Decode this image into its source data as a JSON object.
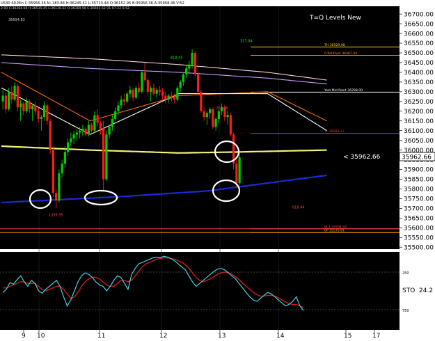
{
  "header": {
    "line1": "US30 60-Min  C:35956.36  N:-183.84  H:36245.41  L:35713.44  O:36152.95  B:35956.36  A:35958.46  V:52",
    "line2": "2.00  C:36364.68  H:36535.45  L:36136.52  O:36169.58  C:36665.52  01-07-22  6:52",
    "indicator_title": "T=Q  Levels  New",
    "corner_value": "36694.83"
  },
  "chart_data": {
    "type": "line",
    "title": "",
    "symbol": "US30",
    "timeframe": "60-Min",
    "price_axis": {
      "ylim": [
        35490,
        36740
      ],
      "ticks": [
        36700,
        36650,
        36600,
        36550,
        36500,
        36450,
        36400,
        36350,
        36300,
        36250,
        36200,
        36150,
        36100,
        36050,
        36000,
        35950,
        35900,
        35850,
        35800,
        35750,
        35700,
        35650,
        35600,
        35550,
        35500
      ],
      "tick_labels": [
        "36700.00",
        "36650.00",
        "36600.00",
        "36550.00",
        "36500.00",
        "36450.00",
        "36400.00",
        "36350.00",
        "36300.00",
        "36250.00",
        "36200.00",
        "36150.00",
        "36100.00",
        "36050.00",
        "36000.00",
        "35950.00",
        "35900.00",
        "35850.00",
        "35800.00",
        "35750.00",
        "35700.00",
        "35650.00",
        "35600.00",
        "35550.00",
        "35500.00"
      ],
      "current_price_label": "35962.66",
      "pointer_label": "< 35962.66"
    },
    "x_axis": {
      "tick_labels": [
        "9",
        "10",
        "11",
        "12",
        "13",
        "14",
        "15",
        "17"
      ],
      "tick_bar_index": [
        5,
        10,
        33,
        57,
        80,
        102,
        126,
        150
      ]
    },
    "bar_count": 110,
    "candles": [
      [
        36250,
        36310,
        36210,
        36280
      ],
      [
        36280,
        36300,
        36190,
        36210
      ],
      [
        36210,
        36320,
        36200,
        36300
      ],
      [
        36300,
        36330,
        36240,
        36260
      ],
      [
        36260,
        36350,
        36250,
        36330
      ],
      [
        36330,
        36340,
        36200,
        36220
      ],
      [
        36220,
        36260,
        36150,
        36240
      ],
      [
        36240,
        36250,
        36180,
        36200
      ],
      [
        36200,
        36270,
        36190,
        36250
      ],
      [
        36250,
        36260,
        36190,
        36210
      ],
      [
        36210,
        36240,
        36150,
        36230
      ],
      [
        36230,
        36250,
        36180,
        36200
      ],
      [
        36200,
        36220,
        36140,
        36160
      ],
      [
        36160,
        36180,
        36100,
        36170
      ],
      [
        36170,
        36250,
        36150,
        36230
      ],
      [
        36230,
        36240,
        36130,
        36150
      ],
      [
        36150,
        36160,
        35980,
        36000
      ],
      [
        36000,
        36020,
        35760,
        35780
      ],
      [
        35780,
        35800,
        35700,
        35740
      ],
      [
        35740,
        35900,
        35730,
        35880
      ],
      [
        35880,
        35950,
        35860,
        35930
      ],
      [
        35930,
        36020,
        35910,
        35990
      ],
      [
        35990,
        36060,
        35970,
        36040
      ],
      [
        36040,
        36090,
        36020,
        36060
      ],
      [
        36060,
        36100,
        36030,
        36080
      ],
      [
        36080,
        36110,
        36050,
        36090
      ],
      [
        36090,
        36120,
        36060,
        36100
      ],
      [
        36100,
        36130,
        36070,
        36110
      ],
      [
        36110,
        36120,
        36070,
        36080
      ],
      [
        36080,
        36150,
        36070,
        36130
      ],
      [
        36130,
        36140,
        36090,
        36100
      ],
      [
        36100,
        36200,
        36090,
        36180
      ],
      [
        36180,
        36210,
        36120,
        36140
      ],
      [
        36140,
        36150,
        36080,
        36110
      ],
      [
        36110,
        36150,
        35790,
        35850
      ],
      [
        35850,
        36100,
        35840,
        36080
      ],
      [
        36080,
        36130,
        36060,
        36120
      ],
      [
        36120,
        36180,
        36100,
        36160
      ],
      [
        36160,
        36220,
        36150,
        36200
      ],
      [
        36200,
        36250,
        36180,
        36230
      ],
      [
        36230,
        36280,
        36210,
        36260
      ],
      [
        36260,
        36290,
        36230,
        36250
      ],
      [
        36250,
        36300,
        36240,
        36290
      ],
      [
        36290,
        36330,
        36270,
        36310
      ],
      [
        36310,
        36320,
        36250,
        36270
      ],
      [
        36270,
        36330,
        36260,
        36320
      ],
      [
        36320,
        36350,
        36290,
        36300
      ],
      [
        36300,
        36410,
        36290,
        36400
      ],
      [
        36400,
        36450,
        36350,
        36360
      ],
      [
        36360,
        36370,
        36280,
        36300
      ],
      [
        36300,
        36330,
        36250,
        36320
      ],
      [
        36320,
        36340,
        36280,
        36290
      ],
      [
        36290,
        36320,
        36270,
        36310
      ],
      [
        36310,
        36330,
        36280,
        36300
      ],
      [
        36300,
        36320,
        36260,
        36280
      ],
      [
        36280,
        36300,
        36240,
        36260
      ],
      [
        36260,
        36290,
        36240,
        36280
      ],
      [
        36280,
        36300,
        36250,
        36270
      ],
      [
        36270,
        36290,
        36240,
        36260
      ],
      [
        36260,
        36330,
        36250,
        36320
      ],
      [
        36320,
        36360,
        36300,
        36350
      ],
      [
        36350,
        36400,
        36330,
        36390
      ],
      [
        36390,
        36440,
        36370,
        36420
      ],
      [
        36420,
        36460,
        36390,
        36440
      ],
      [
        36440,
        36520,
        36420,
        36500
      ],
      [
        36500,
        36510,
        36380,
        36390
      ],
      [
        36390,
        36400,
        36280,
        36300
      ],
      [
        36300,
        36310,
        36190,
        36200
      ],
      [
        36200,
        36220,
        36150,
        36170
      ],
      [
        36170,
        36200,
        36130,
        36190
      ],
      [
        36190,
        36220,
        36160,
        36210
      ],
      [
        36210,
        36220,
        36110,
        36120
      ],
      [
        36120,
        36170,
        36100,
        36160
      ],
      [
        36160,
        36210,
        36140,
        36200
      ],
      [
        36200,
        36240,
        36180,
        36220
      ],
      [
        36220,
        36230,
        36150,
        36170
      ],
      [
        36170,
        36200,
        36130,
        36180
      ],
      [
        36180,
        36190,
        36070,
        36080
      ],
      [
        36080,
        36090,
        35900,
        35930
      ],
      [
        35930,
        35950,
        35810,
        35830
      ],
      [
        35830,
        36000,
        35820,
        35962.66
      ]
    ],
    "candle_times_start_bar": 28,
    "moving_averages": [
      {
        "name": "",
        "color": "#f5f07a",
        "values_sample": [
          [
            0,
            36020
          ],
          [
            30,
            36000
          ],
          [
            60,
            35985
          ],
          [
            80,
            35990
          ],
          [
            110,
            36000
          ]
        ]
      },
      {
        "name": "",
        "color": "#1a2bd6",
        "values_sample": [
          [
            0,
            35730
          ],
          [
            40,
            35760
          ],
          [
            70,
            35790
          ],
          [
            95,
            35840
          ],
          [
            110,
            35870
          ]
        ]
      },
      {
        "name": "",
        "color": "#ffd0e0",
        "values_sample": [
          [
            0,
            36490
          ],
          [
            30,
            36470
          ],
          [
            60,
            36440
          ],
          [
            90,
            36400
          ],
          [
            110,
            36360
          ]
        ]
      },
      {
        "name": "",
        "color": "#c8a0ff",
        "values_sample": [
          [
            0,
            36450
          ],
          [
            30,
            36420
          ],
          [
            60,
            36400
          ],
          [
            90,
            36370
          ],
          [
            110,
            36340
          ]
        ]
      },
      {
        "name": "",
        "color": "#ff6a00",
        "values_sample": [
          [
            0,
            36400
          ],
          [
            30,
            36150
          ],
          [
            60,
            36280
          ],
          [
            90,
            36300
          ],
          [
            110,
            36150
          ]
        ]
      },
      {
        "name": "",
        "color": "#ffffff",
        "values_sample": [
          [
            0,
            36320
          ],
          [
            30,
            36080
          ],
          [
            60,
            36290
          ],
          [
            90,
            36290
          ],
          [
            110,
            36100
          ]
        ]
      }
    ],
    "horizontal_levels": [
      {
        "label": "TH  36529.98",
        "value": 36529.98,
        "color": "#ffd700"
      },
      {
        "label": "0 RollOver  36487.44",
        "value": 36487.44,
        "color": "#ff8c00"
      },
      {
        "label": "Yest Mid Point  36298.00",
        "value": 36298.0,
        "color": "#ffffff"
      },
      {
        "label": "YL  36086.12",
        "value": 36086.12,
        "color": "#ff2020"
      },
      {
        "label": "BL3  35594.54",
        "value": 35594.54,
        "color": "#ff4040"
      },
      {
        "label": "0P  35575.61",
        "value": 35575.61,
        "color": "#ffa500"
      }
    ],
    "annotations": [
      {
        "text": "1359.95",
        "price": 35660,
        "color": "#ff3b3b"
      },
      {
        "text": "818.45",
        "price": 36470,
        "color": "#00ff00"
      },
      {
        "text": "317.04",
        "price": 36555,
        "color": "#00ff00"
      },
      {
        "text": "258.95",
        "price": 36210,
        "color": "#ff3b3b"
      },
      {
        "text": "818.44",
        "price": 35700,
        "color": "#ff3b3b"
      }
    ],
    "stochastic": {
      "label": "STO",
      "value": "24.2",
      "ylim": [
        0,
        1000
      ],
      "tick_labels": [
        "250",
        "750"
      ],
      "fast": [
        480,
        520,
        610,
        590,
        650,
        700,
        620,
        560,
        640,
        600,
        500,
        470,
        520,
        560,
        600,
        640,
        560,
        420,
        300,
        380,
        500,
        620,
        700,
        740,
        720,
        680,
        620,
        580,
        560,
        500,
        560,
        640,
        700,
        680,
        600,
        520,
        720,
        800,
        860,
        880,
        900,
        920,
        940,
        950,
        940,
        960,
        950,
        930,
        900,
        860,
        820,
        780,
        700,
        620,
        560,
        600,
        640,
        680,
        720,
        760,
        790,
        800,
        780,
        740,
        700,
        660,
        600,
        540,
        480,
        420,
        380,
        360,
        400,
        440,
        480,
        460,
        420,
        380,
        340,
        300,
        320,
        360,
        420,
        300,
        240
      ],
      "slow": [
        540,
        540,
        560,
        580,
        600,
        620,
        620,
        600,
        600,
        600,
        560,
        520,
        500,
        520,
        540,
        560,
        560,
        520,
        460,
        400,
        420,
        480,
        560,
        620,
        660,
        680,
        680,
        660,
        620,
        580,
        560,
        560,
        600,
        640,
        640,
        620,
        640,
        700,
        760,
        820,
        860,
        880,
        900,
        920,
        930,
        940,
        940,
        930,
        920,
        900,
        880,
        850,
        800,
        740,
        680,
        640,
        620,
        640,
        660,
        690,
        720,
        740,
        750,
        740,
        720,
        690,
        650,
        600,
        560,
        520,
        480,
        450,
        430,
        430,
        440,
        440,
        430,
        410,
        380,
        350,
        330,
        320,
        320,
        300,
        280
      ]
    },
    "circles_marked": 5
  }
}
